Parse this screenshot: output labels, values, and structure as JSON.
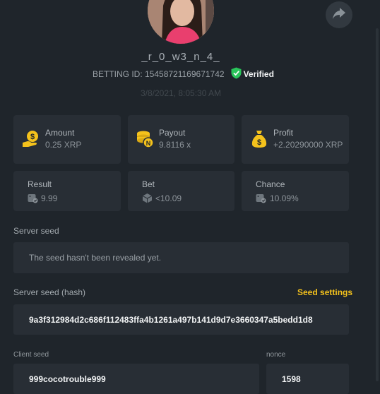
{
  "user": {
    "name": "_r_0_w3_n_4_"
  },
  "bet": {
    "betting_id_label": "BETTING ID: 15458721169671742",
    "verified_label": "Verified",
    "datetime": "3/8/2021, 8:05:30 AM"
  },
  "stats": {
    "amount": {
      "label": "Amount",
      "value": "0.25 XRP"
    },
    "payout": {
      "label": "Payout",
      "value": "9.8116 x"
    },
    "profit": {
      "label": "Profit",
      "value": "+2.20290000 XRP"
    },
    "result": {
      "label": "Result",
      "value": "9.99"
    },
    "bet": {
      "label": "Bet",
      "value": "<10.09"
    },
    "chance": {
      "label": "Chance",
      "value": "10.09%"
    }
  },
  "server_seed": {
    "label": "Server seed",
    "value": "The seed hasn't been revealed yet."
  },
  "server_seed_hash": {
    "label": "Server seed (hash)",
    "settings_link": "Seed settings",
    "value": "9a3f312984d2c686f112483ffa4b1261a497b141d9d7e3660347a5bedd1d8"
  },
  "client_seed": {
    "label": "Client seed",
    "value": "999cocotrouble999"
  },
  "nonce": {
    "label": "nonce",
    "value": "1598"
  },
  "icons": {
    "share": "share-arrow-icon",
    "verified": "shield-check-icon",
    "amount": "coin-hand-icon",
    "payout": "coin-stack-icon",
    "profit": "money-bag-icon",
    "result": "dice-check-icon",
    "bet": "dice-icon",
    "chance": "dice-check-icon"
  },
  "colors": {
    "accent": "#f4c21c",
    "verified": "#29c45a",
    "background": "#1f252b",
    "card": "#282e35"
  }
}
